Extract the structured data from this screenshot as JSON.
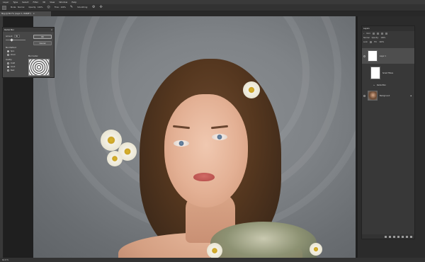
{
  "menu": [
    "Layer",
    "Type",
    "Select",
    "Filter",
    "3D",
    "View",
    "Window",
    "Help"
  ],
  "options": {
    "mode_label": "Mode:",
    "mode_value": "Normal",
    "opacity_label": "Opacity:",
    "opacity_value": "100%",
    "flow_label": "Flow:",
    "flow_value": "100%",
    "smoothing_label": "Smoothing:"
  },
  "document_tab": {
    "title": "Mpg @ 66.7% (Layer 1, RGB/8*)"
  },
  "dialog": {
    "title": "Radial Blur",
    "amount_label": "Amount",
    "amount_value": "30",
    "ok_label": "OK",
    "cancel_label": "Cancel",
    "blur_method_label": "Blur Method:",
    "method_options": [
      "Spin",
      "Zoom"
    ],
    "method_selected": "Spin",
    "quality_label": "Quality:",
    "quality_options": [
      "Draft",
      "Good",
      "Best"
    ],
    "quality_selected": "Good",
    "blur_center_label": "Blur Center"
  },
  "layers_panel": {
    "tab_label": "Layers",
    "kind_label": "Kind",
    "blend_mode": "Normal",
    "opacity_label": "Opacity:",
    "opacity_value": "100%",
    "lock_label": "Lock:",
    "fill_label": "Fill:",
    "fill_value": "100%",
    "layers": [
      {
        "name": "Layer 1"
      },
      {
        "name": "Smart Filters"
      },
      {
        "name": "Radial Blur"
      },
      {
        "name": "Background"
      }
    ]
  },
  "status": {
    "zoom": "66.67%"
  }
}
